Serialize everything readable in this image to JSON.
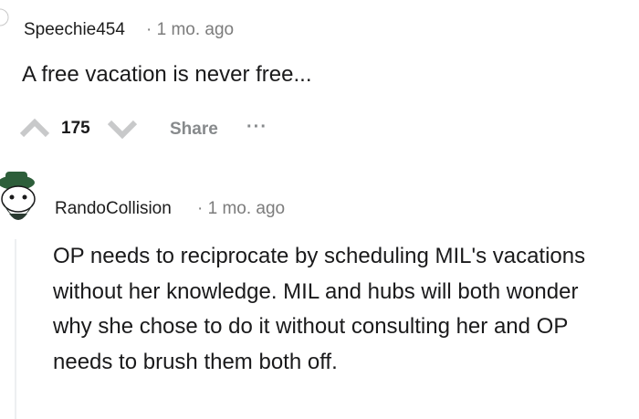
{
  "comments": [
    {
      "author": "Speechie454",
      "separator": "·",
      "time": "1 mo. ago",
      "body": "A free vacation is never free...",
      "score": "175",
      "share_label": "Share",
      "more_label": "···",
      "avatar_icon": "user-avatar-icon",
      "upvote_icon": "upvote-arrow-icon",
      "downvote_icon": "downvote-arrow-icon"
    },
    {
      "author": "RandoCollision",
      "separator": "·",
      "time": "1 mo. ago",
      "body": "OP needs to reciprocate by scheduling MIL's vacations without her knowledge. MIL and hubs will both wonder why she chose to do it without consulting her and OP needs to brush them both off.",
      "avatar_icon": "snoo-avatar-icon",
      "avatar_colors": {
        "hat": "#2d5e3a",
        "face": "#ffffff",
        "beard": "#1f2a24"
      }
    }
  ]
}
